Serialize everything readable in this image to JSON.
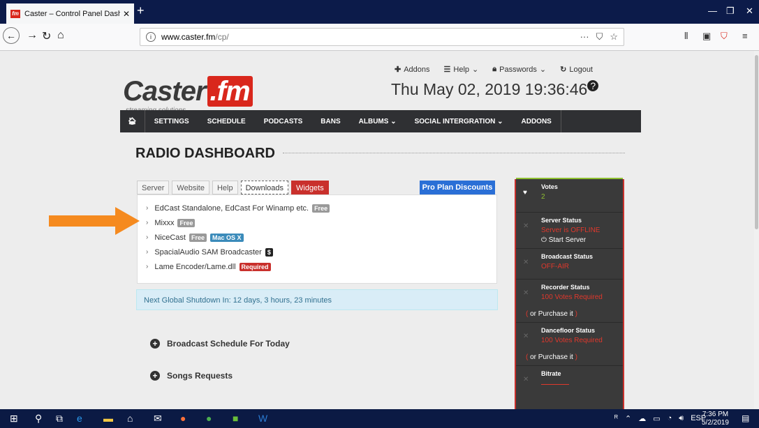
{
  "browser": {
    "tab_title": "Caster – Control Panel Dashbo",
    "tab_favicon": "fm",
    "url_domain": "www.caster.fm",
    "url_path": "/cp/"
  },
  "header": {
    "logo_text": "Caster",
    "logo_fm": ".fm",
    "tagline": "streaming solutions",
    "links": [
      {
        "label": "Addons",
        "icon": "plus-icon"
      },
      {
        "label": "Help",
        "icon": "list-icon"
      },
      {
        "label": "Passwords",
        "icon": "lock-icon"
      },
      {
        "label": "Logout",
        "icon": "logout-icon"
      }
    ],
    "clock": "Thu May 02, 2019 19:36:46"
  },
  "nav": {
    "items": [
      "SETTINGS",
      "SCHEDULE",
      "PODCASTS",
      "BANS",
      "ALBUMS",
      "SOCIAL INTERGRATION",
      "ADDONS"
    ]
  },
  "dashboard": {
    "title": "RADIO DASHBOARD",
    "tabs": [
      "Server",
      "Website",
      "Help",
      "Downloads",
      "Widgets"
    ],
    "pro_button": "Pro Plan Discounts",
    "downloads": [
      {
        "name": "EdCast Standalone, EdCast For Winamp etc.",
        "labels": [
          {
            "text": "Free",
            "color": "grey"
          }
        ]
      },
      {
        "name": "Mixxx",
        "labels": [
          {
            "text": "Free",
            "color": "grey"
          }
        ]
      },
      {
        "name": "NiceCast",
        "labels": [
          {
            "text": "Free",
            "color": "grey"
          },
          {
            "text": "Mac OS X",
            "color": "blue"
          }
        ]
      },
      {
        "name": "SpacialAudio SAM Broadcaster",
        "labels": [
          {
            "text": "$",
            "color": "black"
          }
        ]
      },
      {
        "name": "Lame Encoder/Lame.dll",
        "labels": [
          {
            "text": "Required",
            "color": "red"
          }
        ]
      }
    ],
    "notice": "Next Global Shutdown In: 12 days, 3 hours, 23 minutes",
    "sections": [
      "Broadcast Schedule For Today",
      "Songs Requests"
    ]
  },
  "sidebar": {
    "votes_title": "Votes",
    "votes_value": "2",
    "server_title": "Server Status",
    "server_value": "Server is OFFLINE",
    "server_action": "Start Server",
    "broadcast_title": "Broadcast Status",
    "broadcast_value": "OFF-AIR",
    "recorder_title": "Recorder Status",
    "recorder_value": "100 Votes Required",
    "recorder_sub": "or Purchase it",
    "dancefloor_title": "Dancefloor Status",
    "dancefloor_value": "100 Votes Required",
    "dancefloor_sub": "or Purchase it",
    "bitrate_title": "Bitrate"
  },
  "taskbar": {
    "lang": "ESP",
    "time": "7:36 PM",
    "date": "5/2/2019"
  },
  "colors": {
    "brand_red": "#d9271c",
    "nav_dark": "#2f3033",
    "sidebar_dark": "#3a3a3a",
    "arrow_orange": "#f58a1f"
  }
}
